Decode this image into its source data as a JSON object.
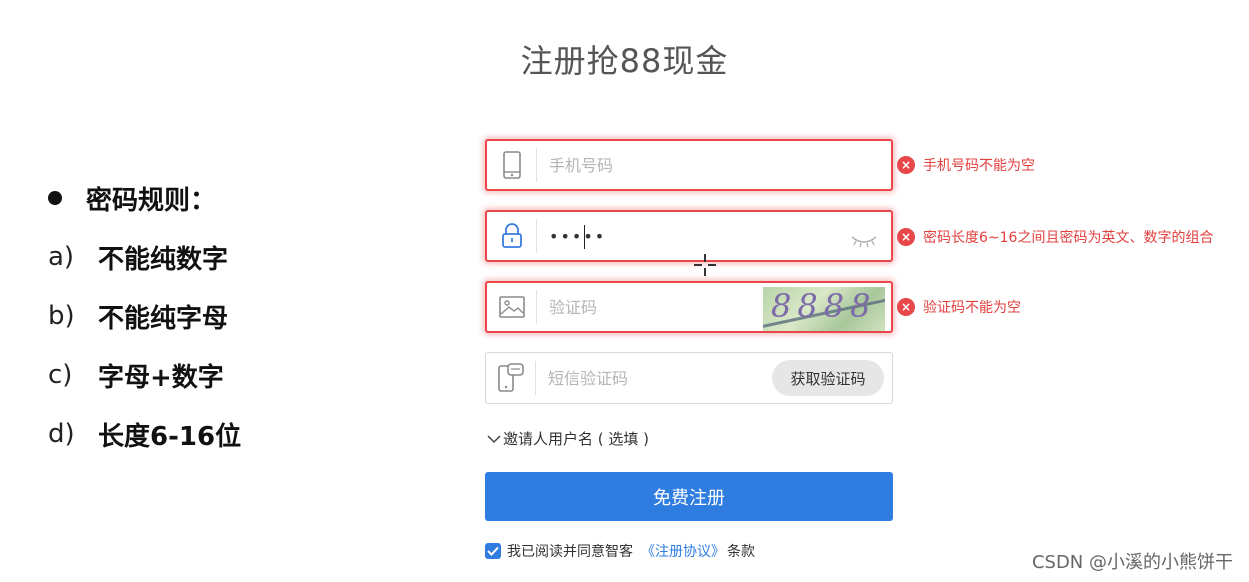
{
  "page": {
    "title": "注册抢88现金"
  },
  "rules": {
    "heading": "密码规则：",
    "items": [
      {
        "prefix": "a)",
        "text": "不能纯数字"
      },
      {
        "prefix": "b)",
        "text": "不能纯字母"
      },
      {
        "prefix": "c)",
        "text": "字母+数字"
      },
      {
        "prefix": "d)",
        "text": "长度6-16位"
      }
    ]
  },
  "form": {
    "phone": {
      "placeholder": "手机号码",
      "icon": "phone-icon",
      "error": "手机号码不能为空"
    },
    "password": {
      "value": "•••••",
      "icon": "lock-icon",
      "error": "密码长度6~16之间且密码为英文、数字的组合"
    },
    "captcha": {
      "placeholder": "验证码",
      "icon": "image-icon",
      "code": "8888",
      "error": "验证码不能为空"
    },
    "sms": {
      "placeholder": "短信验证码",
      "icon": "sms-phone-icon",
      "button": "获取验证码"
    },
    "invite_label": "邀请人用户名 ( 选填 )",
    "submit_label": "免费注册",
    "agree": {
      "prefix": "我已阅读并同意智客",
      "link": "《注册协议》",
      "suffix": "条款",
      "checked": true
    }
  },
  "colors": {
    "error": "#e8484a",
    "primary": "#2f7de1"
  },
  "watermark": "CSDN @小溪的小熊饼干"
}
